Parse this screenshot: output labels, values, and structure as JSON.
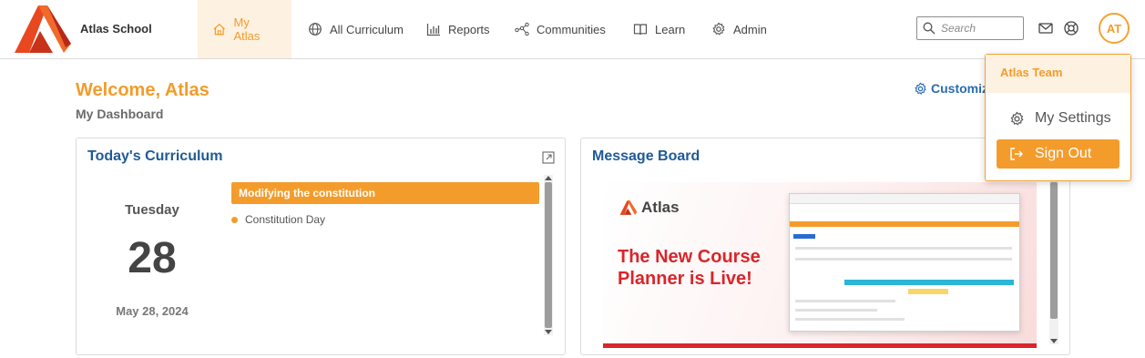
{
  "brand": {
    "name": "Atlas School",
    "accent": "#f29c2b",
    "link": "#1f5a96"
  },
  "nav": {
    "items": [
      {
        "label": "My Atlas",
        "icon": "home-icon",
        "active": true
      },
      {
        "label": "All Curriculum",
        "icon": "globe-icon",
        "active": false
      },
      {
        "label": "Reports",
        "icon": "bar-chart-icon",
        "active": false
      },
      {
        "label": "Communities",
        "icon": "network-icon",
        "active": false
      },
      {
        "label": "Learn",
        "icon": "book-icon",
        "active": false
      },
      {
        "label": "Admin",
        "icon": "gear-icon",
        "active": false
      }
    ],
    "search_placeholder": "Search",
    "avatar_initials": "AT"
  },
  "dashboard": {
    "welcome": "Welcome, Atlas",
    "subtitle": "My Dashboard",
    "customize": "Customize"
  },
  "curriculum": {
    "title": "Today's Curriculum",
    "day_name": "Tuesday",
    "day_number": "28",
    "date": "May 28, 2024",
    "lesson": "Modifying the constitution",
    "event": "Constitution Day"
  },
  "message_board": {
    "title": "Message Board",
    "banner_logo": "Atlas",
    "banner_headline": "The New Course Planner is Live!"
  },
  "user_menu": {
    "team": "Atlas Team",
    "settings": "My Settings",
    "sign_out": "Sign Out"
  }
}
